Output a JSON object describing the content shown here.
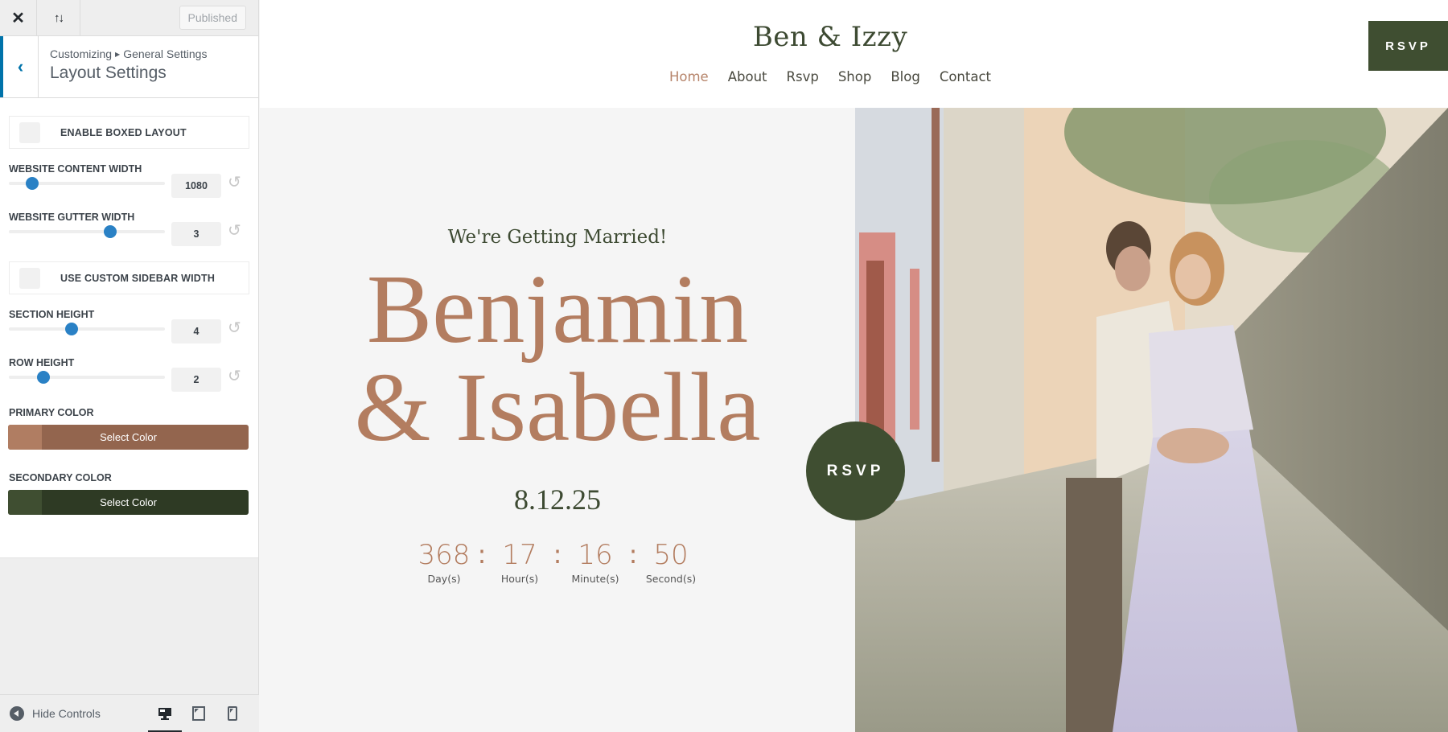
{
  "customizer": {
    "topbar": {
      "close_icon": "close-icon",
      "reorder_icon": "sort-arrows-icon",
      "published_label": "Published"
    },
    "section": {
      "breadcrumb_root": "Customizing",
      "breadcrumb_parent": "General Settings",
      "title": "Layout Settings"
    },
    "controls": {
      "boxed_layout": {
        "label": "ENABLE BOXED LAYOUT",
        "checked": false
      },
      "content_width": {
        "label": "WEBSITE CONTENT WIDTH",
        "value": "1080",
        "slider_fraction": 0.15
      },
      "gutter_width": {
        "label": "WEBSITE GUTTER WIDTH",
        "value": "3",
        "slider_fraction": 0.65
      },
      "custom_sidebar": {
        "label": "USE CUSTOM SIDEBAR WIDTH",
        "checked": false
      },
      "section_height": {
        "label": "SECTION HEIGHT",
        "value": "4",
        "slider_fraction": 0.4
      },
      "row_height": {
        "label": "ROW HEIGHT",
        "value": "2",
        "slider_fraction": 0.22
      },
      "primary_color": {
        "label": "PRIMARY COLOR",
        "button_label": "Select Color",
        "swatch": "#b07d62",
        "button_bg": "#93654e"
      },
      "secondary_color": {
        "label": "SECONDARY COLOR",
        "button_label": "Select Color",
        "swatch": "#3f4e31",
        "button_bg": "#2e3a24"
      }
    },
    "footer": {
      "hide_controls_label": "Hide Controls",
      "devices": [
        {
          "name": "desktop",
          "icon": "desktop-icon",
          "active": true
        },
        {
          "name": "tablet",
          "icon": "tablet-icon",
          "active": false
        },
        {
          "name": "mobile",
          "icon": "mobile-icon",
          "active": false
        }
      ]
    }
  },
  "site": {
    "title": "Ben & Izzy",
    "nav": [
      "Home",
      "About",
      "Rsvp",
      "Shop",
      "Blog",
      "Contact"
    ],
    "nav_active": "Home",
    "rsvp_button": "RSVP",
    "hero": {
      "tagline": "We're Getting Married!",
      "names_line1": "Benjamin",
      "names_line2": "& Isabella",
      "date": "8.12.25",
      "countdown": [
        {
          "value": "368",
          "label": "Day(s)"
        },
        {
          "value": "17",
          "label": "Hour(s)"
        },
        {
          "value": "16",
          "label": "Minute(s)"
        },
        {
          "value": "50",
          "label": "Second(s)"
        }
      ],
      "rsvp_circle": "RSVP",
      "photo": "couple-embracing-cobblestone-alley"
    },
    "colors": {
      "accent": "#b37d60",
      "dark_green": "#3f4e31"
    }
  }
}
